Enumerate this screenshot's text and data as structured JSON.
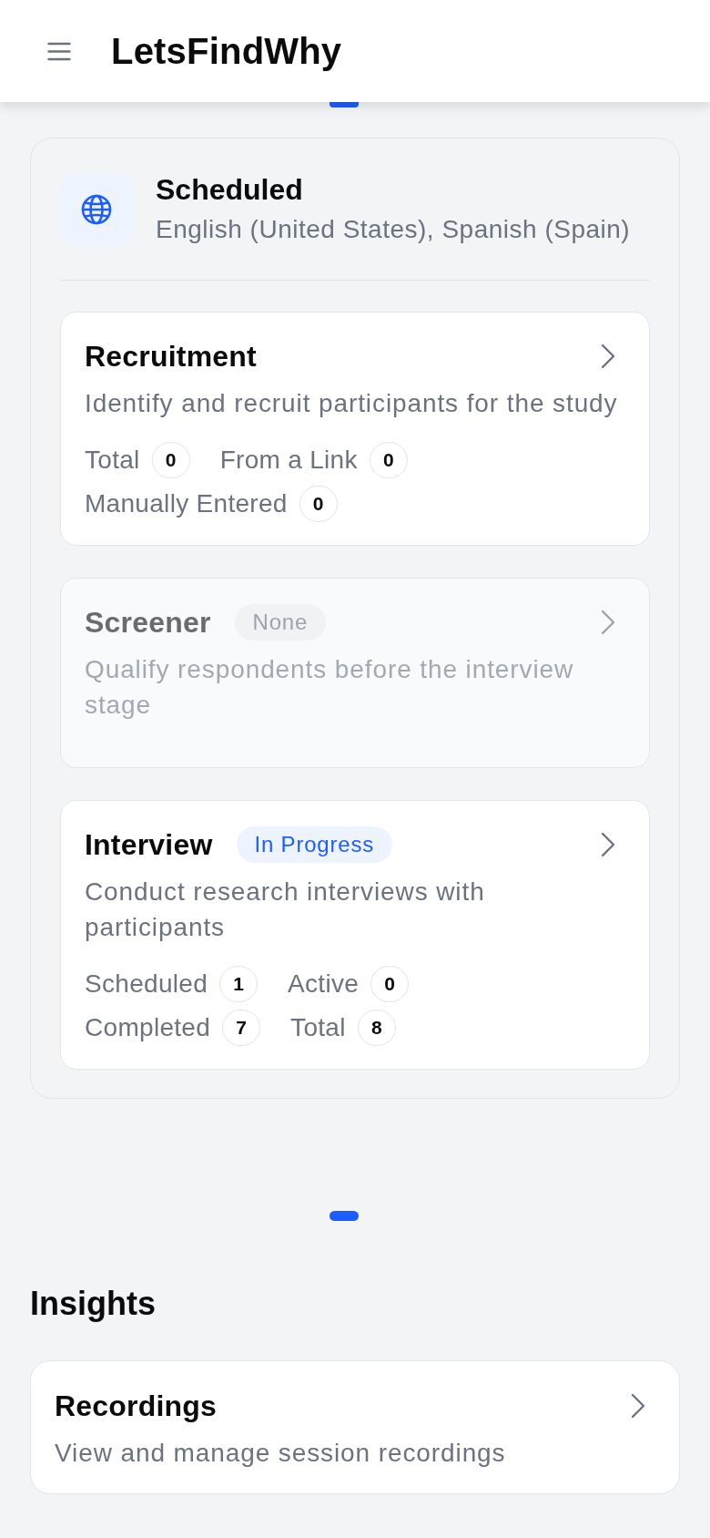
{
  "app_bar": {
    "title": "LetsFindWhy"
  },
  "top_pager": {
    "dots": [
      {
        "selected": true
      }
    ]
  },
  "study": {
    "status": "Scheduled",
    "languages": "English (United States), Spanish (Spain)",
    "stages": [
      {
        "title": "Recruitment",
        "disabled": false,
        "description": "Identify and recruit participants for the study",
        "stat_rows": [
          [
            {
              "label": "Total",
              "count": "0"
            },
            {
              "label": "From a Link",
              "count": "0"
            }
          ],
          [
            {
              "label": "Manually Entered",
              "count": "0"
            }
          ]
        ]
      },
      {
        "title": "Screener",
        "disabled": true,
        "badge": {
          "label": "None",
          "kind": "neutral"
        },
        "description": "Qualify respondents before the interview stage"
      },
      {
        "title": "Interview",
        "disabled": false,
        "badge": {
          "label": "In Progress",
          "kind": "active"
        },
        "description": "Conduct research interviews with participants",
        "stat_rows": [
          [
            {
              "label": "Scheduled",
              "count": "1"
            },
            {
              "label": "Active",
              "count": "0"
            }
          ],
          [
            {
              "label": "Completed",
              "count": "7"
            },
            {
              "label": "Total",
              "count": "8"
            }
          ]
        ]
      }
    ]
  },
  "pager": {
    "dots": [
      {
        "selected": true
      }
    ]
  },
  "insights": {
    "heading": "Insights",
    "items": [
      {
        "title": "Recordings",
        "description": "View and manage session recordings"
      }
    ]
  }
}
